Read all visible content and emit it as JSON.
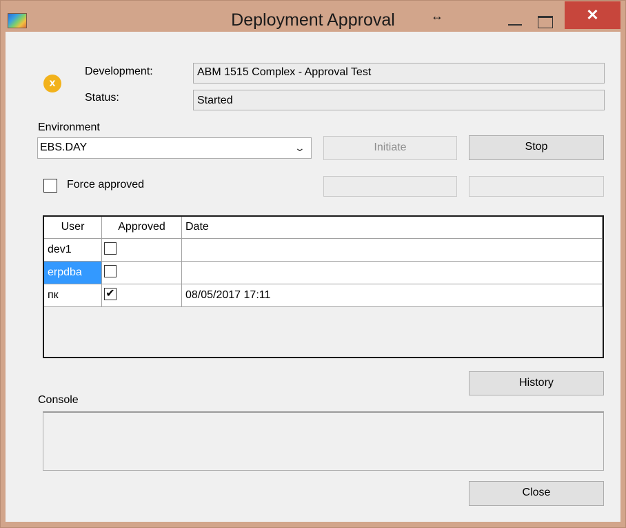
{
  "window": {
    "title": "Deployment Approval",
    "close_glyph": "✕",
    "resize_glyph": "↔"
  },
  "info": {
    "status_icon_glyph": "x",
    "development_label": "Development:",
    "development_value": "ABM 1515 Complex - Approval Test",
    "status_label": "Status:",
    "status_value": "Started"
  },
  "environment": {
    "label": "Environment",
    "selected": "EBS.DAY",
    "arrow": "⌄"
  },
  "buttons": {
    "initiate": "Initiate",
    "stop": "Stop",
    "history": "History",
    "close": "Close"
  },
  "force_approved": {
    "label": "Force approved",
    "checked": false
  },
  "grid": {
    "columns": [
      "User",
      "Approved",
      "Date"
    ],
    "rows": [
      {
        "user": "dev1",
        "approved": "",
        "date": ""
      },
      {
        "user": "erpdba",
        "approved": "",
        "date": "",
        "selected": true
      },
      {
        "user": "пк",
        "approved": "✔",
        "date": "08/05/2017 17:11"
      }
    ]
  },
  "console": {
    "label": "Console",
    "text": ""
  },
  "colors": {
    "titlebar": "#d2a58b",
    "close": "#c7463c",
    "selection": "#3399ff",
    "status_icon": "#f2b21b"
  }
}
